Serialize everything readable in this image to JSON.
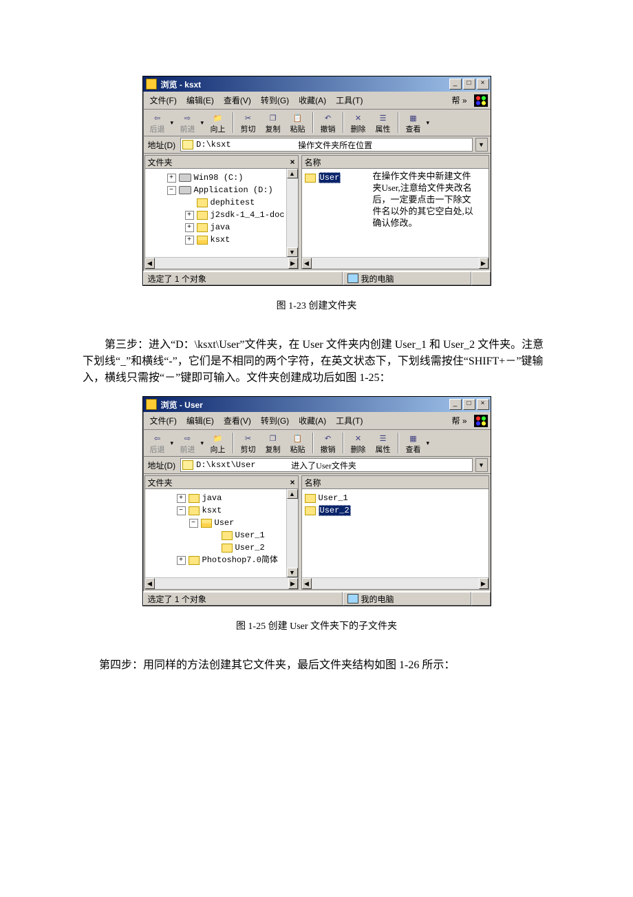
{
  "window1": {
    "title": "浏览 - ksxt",
    "menu": {
      "file": "文件(F)",
      "edit": "编辑(E)",
      "view": "查看(V)",
      "go": "转到(G)",
      "fav": "收藏(A)",
      "tools": "工具(T)",
      "help": "帮 »"
    },
    "toolbar": {
      "back": "后退",
      "forward": "前进",
      "up": "向上",
      "cut": "剪切",
      "copy": "复制",
      "paste": "粘贴",
      "undo": "撤销",
      "delete": "删除",
      "props": "属性",
      "views": "查看"
    },
    "address": {
      "label": "地址(D)",
      "path": "D:\\ksxt",
      "note": "操作文件夹所在位置"
    },
    "left_header": "文件夹",
    "right_header": "名称",
    "tree": {
      "n0": "Win98 (C:)",
      "n1": "Application (D:)",
      "n2": "dephitest",
      "n3": "j2sdk-1_4_1-doc",
      "n4": "java",
      "n5": "ksxt"
    },
    "file": "User",
    "note": "在操作文件夹中新建文件夹User,注意给文件夹改名后，一定要点击一下除文件名以外的其它空白处,以确认修改。",
    "status_left": "选定了 1 个对象",
    "status_right": "我的电脑"
  },
  "caption1": "图 1-23  创建文件夹",
  "para1": "第三步：进入“D：\\ksxt\\User”文件夹，在 User 文件夹内创建 User_1 和 User_2 文件夹。注意下划线“_”和横线“-”，它们是不相同的两个字符，在英文状态下，下划线需按住“SHIFT+－”键输入，横线只需按“－”键即可输入。文件夹创建成功后如图 1-25：",
  "window2": {
    "title": "浏览 - User",
    "address": {
      "label": "地址(D)",
      "path": "D:\\ksxt\\User",
      "note": "进入了User文件夹"
    },
    "left_header": "文件夹",
    "right_header": "名称",
    "tree": {
      "n0": "java",
      "n1": "ksxt",
      "n2": "User",
      "n3": "User_1",
      "n4": "User_2",
      "n5": "Photoshop7.0简体"
    },
    "file1": "User_1",
    "file2": "User_2",
    "status_left": "选定了 1 个对象",
    "status_right": "我的电脑"
  },
  "caption2": "图 1-25  创建 User 文件夹下的子文件夹",
  "para2": "第四步：用同样的方法创建其它文件夹，最后文件夹结构如图 1-26 所示："
}
